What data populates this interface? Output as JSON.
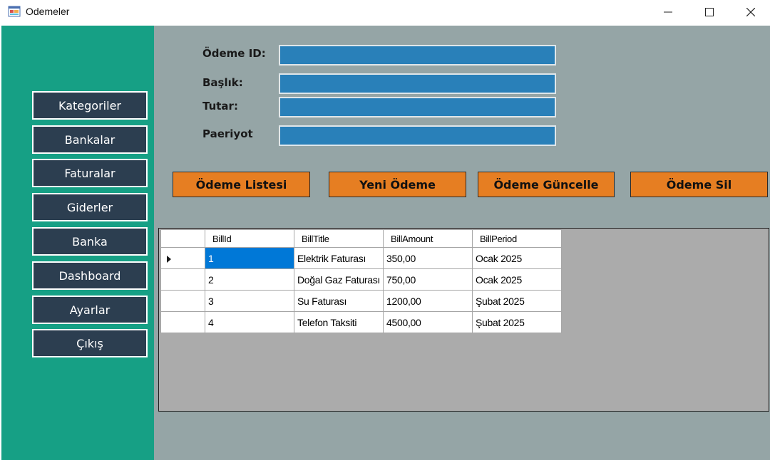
{
  "window": {
    "title": "Odemeler"
  },
  "sidebar": {
    "items": [
      {
        "label": "Kategoriler"
      },
      {
        "label": "Bankalar"
      },
      {
        "label": "Faturalar"
      },
      {
        "label": "Giderler"
      },
      {
        "label": "Banka"
      },
      {
        "label": "Dashboard"
      },
      {
        "label": "Ayarlar"
      },
      {
        "label": "Çıkış"
      }
    ]
  },
  "form": {
    "id_label": "Ödeme ID:",
    "title_label": "Başlık:",
    "amount_label": "Tutar:",
    "period_label": "Paeriyot",
    "id_value": "",
    "title_value": "",
    "amount_value": "",
    "period_value": ""
  },
  "actions": {
    "list": "Ödeme Listesi",
    "new": "Yeni Ödeme",
    "update": "Ödeme Güncelle",
    "delete": "Ödeme Sil"
  },
  "grid": {
    "columns": [
      "BillId",
      "BillTitle",
      "BillAmount",
      "BillPeriod"
    ],
    "rows": [
      [
        "1",
        "Elektrik Faturası",
        "350,00",
        "Ocak 2025"
      ],
      [
        "2",
        "Doğal Gaz Faturası",
        "750,00",
        "Ocak 2025"
      ],
      [
        "3",
        "Su Faturası",
        "1200,00",
        "Şubat 2025"
      ],
      [
        "4",
        "Telefon Taksiti",
        "4500,00",
        "Şubat 2025"
      ]
    ]
  },
  "colors": {
    "sidebar": "#16a085",
    "nav_button": "#2c3e50",
    "main_bg": "#95a5a6",
    "input_bg": "#2980b9",
    "action_button": "#e67e22",
    "selected_cell": "#0078d7"
  }
}
